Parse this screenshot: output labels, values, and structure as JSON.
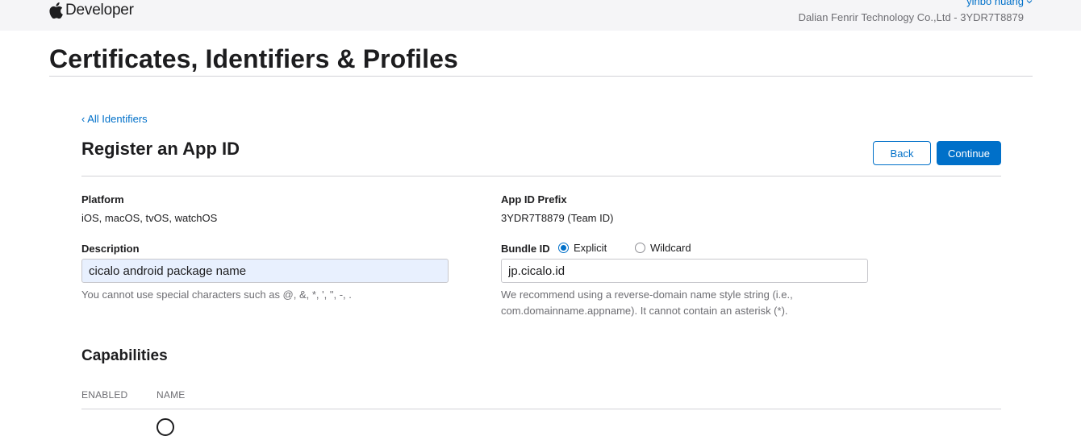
{
  "header": {
    "brand": "Developer",
    "user_name": "yinbo huang",
    "team_line": "Dalian Fenrir Technology Co.,Ltd - 3YDR7T8879"
  },
  "page": {
    "title": "Certificates, Identifiers & Profiles"
  },
  "nav": {
    "back_link": "All Identifiers"
  },
  "form": {
    "title": "Register an App ID",
    "back_label": "Back",
    "continue_label": "Continue",
    "platform": {
      "label": "Platform",
      "value": "iOS, macOS, tvOS, watchOS"
    },
    "app_id_prefix": {
      "label": "App ID Prefix",
      "value": "3YDR7T8879 (Team ID)"
    },
    "description": {
      "label": "Description",
      "value": "cicalo android package name",
      "help": "You cannot use special characters such as @, &, *, ', \", -, ."
    },
    "bundle_id": {
      "label": "Bundle ID",
      "options": [
        {
          "label": "Explicit",
          "checked": true
        },
        {
          "label": "Wildcard",
          "checked": false
        }
      ],
      "value": "jp.cicalo.id",
      "help_line1": "We recommend using a reverse-domain name style string (i.e.,",
      "help_line2": "com.domainname.appname). It cannot contain an asterisk (*)."
    }
  },
  "capabilities": {
    "title": "Capabilities",
    "columns": [
      "ENABLED",
      "NAME"
    ]
  },
  "colors": {
    "accent": "#0070c9",
    "text": "#1d1d1f",
    "muted": "#6e6e73",
    "autofill_bg": "#e8f0fe"
  }
}
